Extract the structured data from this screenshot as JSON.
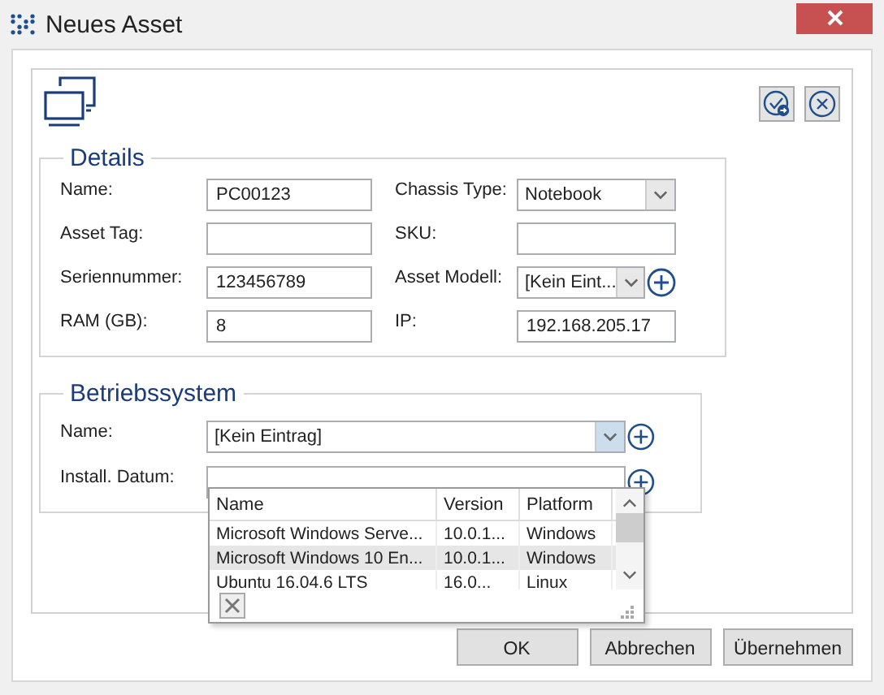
{
  "window": {
    "title": "Neues Asset"
  },
  "details": {
    "title": "Details",
    "fields": [
      {
        "label": "Name:",
        "value": "PC00123",
        "kind": "text"
      },
      {
        "label": "Chassis Type:",
        "value": "Notebook",
        "kind": "select"
      },
      {
        "label": "Asset Tag:",
        "kind": "text"
      },
      {
        "label": "SKU:",
        "kind": "text"
      },
      {
        "label": "Seriennummer:",
        "value": "123456789",
        "kind": "text"
      },
      {
        "label": "Asset Modell:",
        "value": "[Kein Eint...",
        "kind": "select_add"
      },
      {
        "label": "RAM (GB):",
        "value": "8",
        "kind": "text"
      },
      {
        "label": "IP:",
        "value": "192.168.205.17",
        "kind": "text"
      }
    ]
  },
  "os": {
    "title": "Betriebssystem",
    "name": {
      "label": "Name:",
      "value": "[Kein Eintrag]",
      "expanded": true
    },
    "install_date": {
      "label": "Install. Datum:"
    },
    "dropdown": {
      "columns": [
        "Name",
        "Version",
        "Platform"
      ],
      "rows": [
        {
          "cells": [
            "Microsoft Windows Serve...",
            "10.0.1...",
            "Windows"
          ],
          "selected": false
        },
        {
          "cells": [
            "Microsoft Windows 10 En...",
            "10.0.1...",
            "Windows"
          ],
          "selected": true
        },
        {
          "cells": [
            "Ubuntu 16.04.6 LTS",
            "16.0...",
            "Linux"
          ],
          "selected": false
        }
      ]
    }
  },
  "buttons": [
    "OK",
    "Abbrechen",
    "Übernehmen"
  ]
}
